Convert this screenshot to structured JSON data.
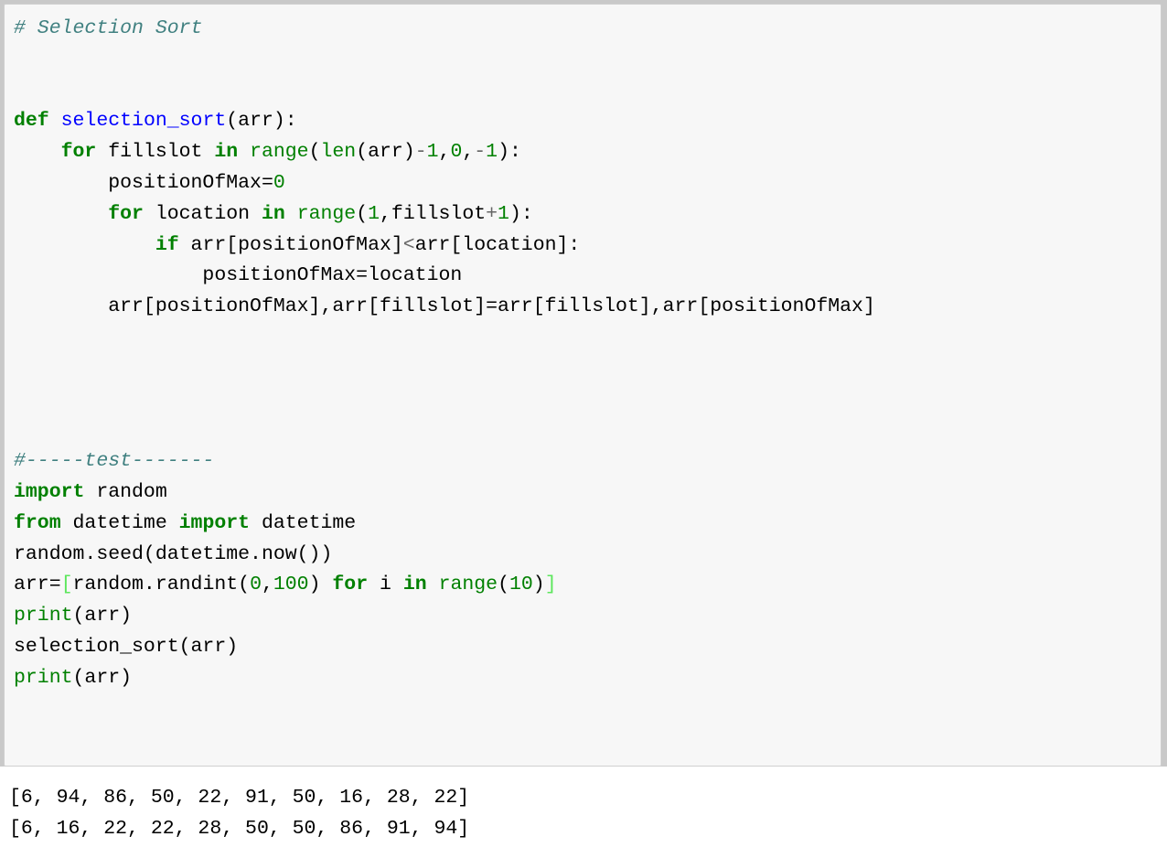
{
  "colors": {
    "page_background": "#ffffff",
    "gutter": "#c9c9c9",
    "cell_background": "#f7f7f7",
    "cell_border": "#cfcfcf",
    "comment": "#408080",
    "keyword": "#008000",
    "builtin": "#008000",
    "function_name": "#0000ff",
    "number": "#008000",
    "operator": "#aa22ff",
    "bracket_match": "#5ce65c",
    "text": "#000000"
  },
  "cell": {
    "name": "code-cell",
    "lines": [
      {
        "tokens": [
          {
            "t": "# Selection Sort",
            "c": "comment"
          }
        ]
      },
      {
        "tokens": []
      },
      {
        "tokens": []
      },
      {
        "tokens": [
          {
            "t": "def",
            "c": "keyword"
          },
          {
            "t": " ",
            "c": "plain"
          },
          {
            "t": "selection_sort",
            "c": "funcname"
          },
          {
            "t": "(arr):",
            "c": "plain"
          }
        ]
      },
      {
        "tokens": [
          {
            "t": "    ",
            "c": "plain"
          },
          {
            "t": "for",
            "c": "keyword"
          },
          {
            "t": " fillslot ",
            "c": "plain"
          },
          {
            "t": "in",
            "c": "keyword"
          },
          {
            "t": " ",
            "c": "plain"
          },
          {
            "t": "range",
            "c": "builtin"
          },
          {
            "t": "(",
            "c": "plain"
          },
          {
            "t": "len",
            "c": "builtin"
          },
          {
            "t": "(arr)",
            "c": "plain"
          },
          {
            "t": "-",
            "c": "operator"
          },
          {
            "t": "1",
            "c": "number"
          },
          {
            "t": ",",
            "c": "plain"
          },
          {
            "t": "0",
            "c": "number"
          },
          {
            "t": ",",
            "c": "plain"
          },
          {
            "t": "-",
            "c": "operator"
          },
          {
            "t": "1",
            "c": "number"
          },
          {
            "t": "):",
            "c": "plain"
          }
        ]
      },
      {
        "tokens": [
          {
            "t": "        positionOfMax=",
            "c": "plain"
          },
          {
            "t": "0",
            "c": "number"
          }
        ]
      },
      {
        "tokens": [
          {
            "t": "        ",
            "c": "plain"
          },
          {
            "t": "for",
            "c": "keyword"
          },
          {
            "t": " location ",
            "c": "plain"
          },
          {
            "t": "in",
            "c": "keyword"
          },
          {
            "t": " ",
            "c": "plain"
          },
          {
            "t": "range",
            "c": "builtin"
          },
          {
            "t": "(",
            "c": "plain"
          },
          {
            "t": "1",
            "c": "number"
          },
          {
            "t": ",fillslot",
            "c": "plain"
          },
          {
            "t": "+",
            "c": "operator"
          },
          {
            "t": "1",
            "c": "number"
          },
          {
            "t": "):",
            "c": "plain"
          }
        ]
      },
      {
        "tokens": [
          {
            "t": "            ",
            "c": "plain"
          },
          {
            "t": "if",
            "c": "keyword"
          },
          {
            "t": " arr[positionOfMax]",
            "c": "plain"
          },
          {
            "t": "<",
            "c": "operator"
          },
          {
            "t": "arr[location]:",
            "c": "plain"
          }
        ]
      },
      {
        "tokens": [
          {
            "t": "                positionOfMax=location",
            "c": "plain"
          }
        ]
      },
      {
        "tokens": [
          {
            "t": "        arr[positionOfMax],arr[fillslot]=arr[fillslot],arr[positionOfMax]",
            "c": "plain"
          }
        ]
      },
      {
        "tokens": []
      },
      {
        "tokens": []
      },
      {
        "tokens": []
      },
      {
        "tokens": []
      },
      {
        "tokens": [
          {
            "t": "#-----test-------",
            "c": "comment"
          }
        ]
      },
      {
        "tokens": [
          {
            "t": "import",
            "c": "keyword"
          },
          {
            "t": " random",
            "c": "plain"
          }
        ]
      },
      {
        "tokens": [
          {
            "t": "from",
            "c": "keyword"
          },
          {
            "t": " datetime ",
            "c": "plain"
          },
          {
            "t": "import",
            "c": "keyword"
          },
          {
            "t": " datetime",
            "c": "plain"
          }
        ]
      },
      {
        "tokens": [
          {
            "t": "random.seed(datetime.now())",
            "c": "plain"
          }
        ]
      },
      {
        "tokens": [
          {
            "t": "arr=",
            "c": "plain"
          },
          {
            "t": "[",
            "c": "bracket"
          },
          {
            "t": "random.randint(",
            "c": "plain"
          },
          {
            "t": "0",
            "c": "number"
          },
          {
            "t": ",",
            "c": "plain"
          },
          {
            "t": "100",
            "c": "number"
          },
          {
            "t": ") ",
            "c": "plain"
          },
          {
            "t": "for",
            "c": "keyword"
          },
          {
            "t": " i ",
            "c": "plain"
          },
          {
            "t": "in",
            "c": "keyword"
          },
          {
            "t": " ",
            "c": "plain"
          },
          {
            "t": "range",
            "c": "builtin"
          },
          {
            "t": "(",
            "c": "plain"
          },
          {
            "t": "10",
            "c": "number"
          },
          {
            "t": ")",
            "c": "plain"
          },
          {
            "t": "]",
            "c": "bracket"
          }
        ]
      },
      {
        "tokens": [
          {
            "t": "print",
            "c": "builtin"
          },
          {
            "t": "(arr)",
            "c": "plain"
          }
        ]
      },
      {
        "tokens": [
          {
            "t": "selection_sort(arr)",
            "c": "plain"
          }
        ]
      },
      {
        "tokens": [
          {
            "t": "print",
            "c": "builtin"
          },
          {
            "t": "(arr)",
            "c": "plain"
          }
        ]
      }
    ]
  },
  "output": {
    "name": "cell-output",
    "lines": [
      "[6, 94, 86, 50, 22, 91, 50, 16, 28, 22]",
      "[6, 16, 22, 22, 28, 50, 50, 86, 91, 94]"
    ]
  }
}
